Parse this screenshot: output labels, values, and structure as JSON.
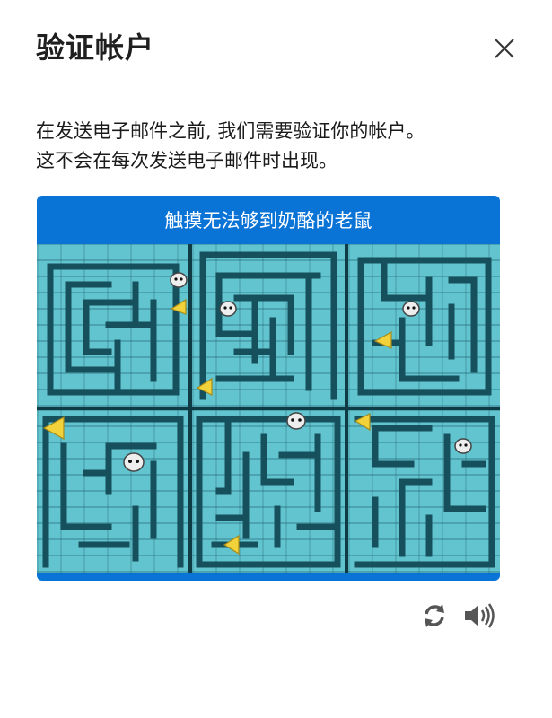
{
  "dialog": {
    "title": "验证帐户",
    "close_icon": "close-icon",
    "description_line1": "在发送电子邮件之前, 我们需要验证你的帐户。",
    "description_line2": "这不会在每次发送电子邮件时出现。"
  },
  "captcha": {
    "instruction": "触摸无法够到奶酪的老鼠",
    "accent_color": "#0a73d6",
    "tiles": [
      {
        "label": "maze tile 1"
      },
      {
        "label": "maze tile 2"
      },
      {
        "label": "maze tile 3"
      },
      {
        "label": "maze tile 4"
      },
      {
        "label": "maze tile 5"
      },
      {
        "label": "maze tile 6"
      }
    ],
    "refresh_icon": "refresh-icon",
    "audio_icon": "speaker-icon"
  }
}
